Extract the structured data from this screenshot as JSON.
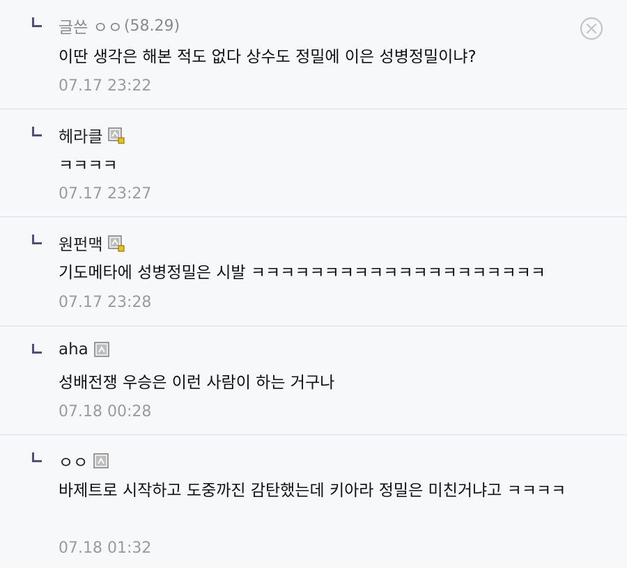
{
  "comments": [
    {
      "nick": "글쓴 ㅇㅇ",
      "ip": "(58.29)",
      "text": "이딴 생각은 해본 적도 없다 상수도 정밀에 이은 성병정밀이냐?",
      "date": "07.17 23:22",
      "badge": "none"
    },
    {
      "nick": "헤라클",
      "text": "ㅋㅋㅋㅋ",
      "date": "07.17 23:27",
      "badge": "fixed-nick-icon"
    },
    {
      "nick": "원펀맥",
      "text": "기도메타에 성병정밀은 시발 ㅋㅋㅋㅋㅋㅋㅋㅋㅋㅋㅋㅋㅋㅋㅋㅋㅋㅋㅋㅋ",
      "date": "07.17 23:28",
      "badge": "fixed-nick-icon"
    },
    {
      "nick": "aha",
      "text": "성배전쟁 우승은 이런 사람이 하는 거구나",
      "date": "07.18 00:28",
      "badge": "nick-icon"
    },
    {
      "nick": "ㅇㅇ",
      "text": "바제트로 시작하고 도중까진 감탄했는데 키아라 정밀은 미친거냐고 ㅋㅋㅋㅋ",
      "date": "07.18 01:32",
      "badge": "nick-icon"
    }
  ],
  "colors": {
    "background": "#f7f8fa",
    "divider": "#dcdde2",
    "reply_mark": "#4a4f8c",
    "date": "#9b9b9b",
    "badge_dot": "#f2c200"
  },
  "icons": {
    "close": "close-circle-icon",
    "reply": "reply-arrow-icon"
  }
}
